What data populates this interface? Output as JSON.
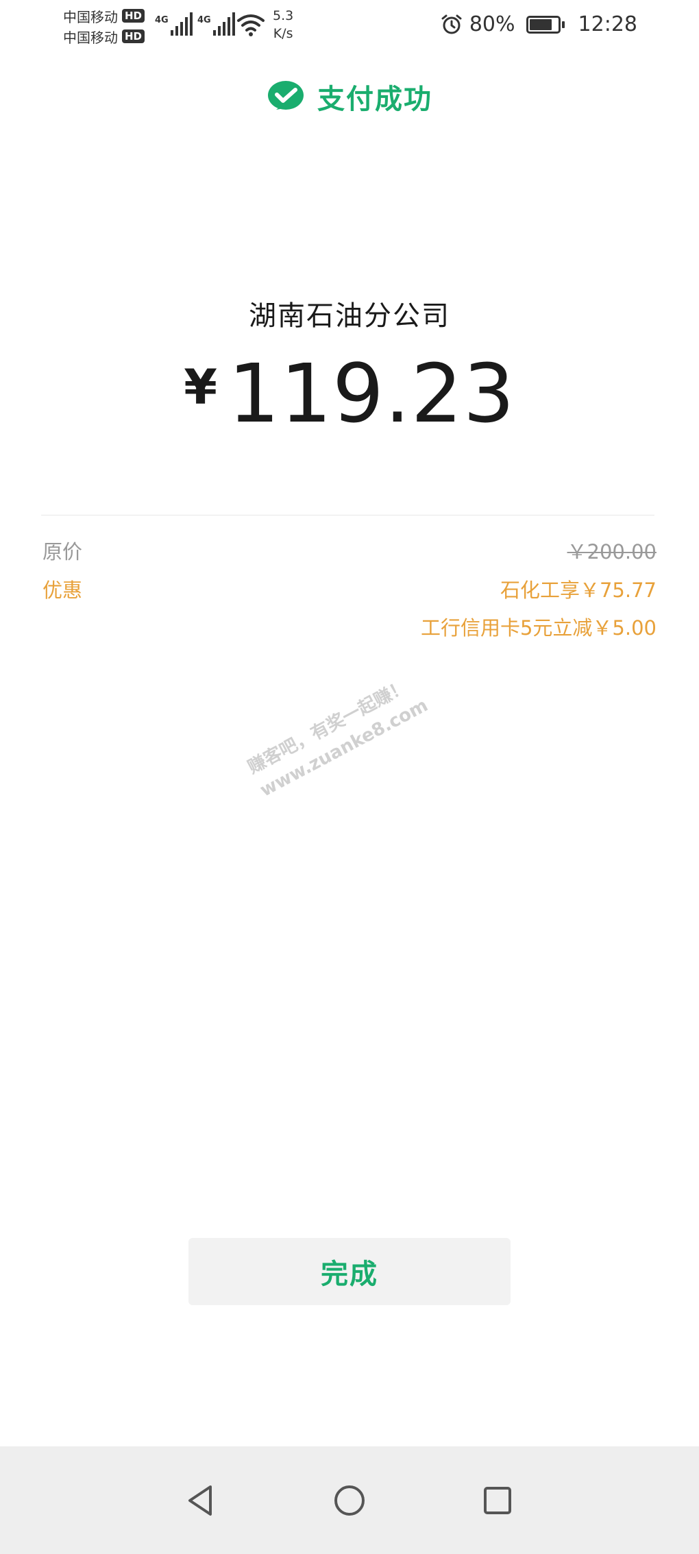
{
  "status_bar": {
    "carrier_1": "中国移动",
    "carrier_2": "中国移动",
    "hd_label": "HD",
    "network_1": "4G",
    "network_2": "4G",
    "speed_value": "5.3",
    "speed_unit": "K/s",
    "battery_percent": "80%",
    "battery_level": 0.8,
    "time": "12:28",
    "icons": [
      "signal-icon",
      "wifi-icon",
      "alarm-icon",
      "battery-icon"
    ]
  },
  "header": {
    "title": "支付成功",
    "icon": "wechat-pay-check-icon",
    "accent_color": "#1aad6e"
  },
  "payment": {
    "merchant": "湖南石油分公司",
    "currency_symbol": "¥",
    "amount": "119.23"
  },
  "details": {
    "original_label": "原价",
    "original_value": "￥200.00",
    "discount_label": "优惠",
    "discounts": [
      "石化工享￥75.77",
      "工行信用卡5元立减￥5.00"
    ],
    "discount_color": "#e8a13a"
  },
  "watermark": {
    "line_1": "赚客吧，有奖一起赚！",
    "line_2": "www.zuanke8.com"
  },
  "actions": {
    "done_label": "完成"
  },
  "nav_bar": {
    "icons": [
      "back-icon",
      "home-icon",
      "recents-icon"
    ]
  }
}
